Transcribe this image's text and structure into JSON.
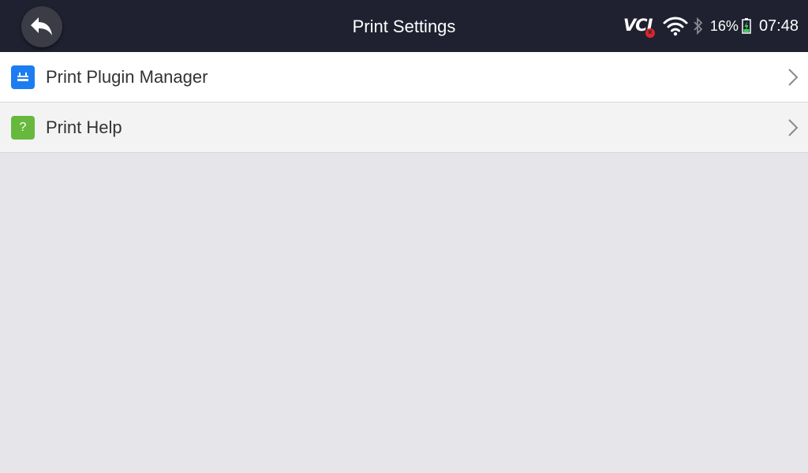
{
  "header": {
    "title": "Print Settings",
    "back_icon": "back-arrow-icon"
  },
  "status_bar": {
    "vci_label": "VCI",
    "vci_state_icon": "disconnected-x-icon",
    "battery_percent": "16%",
    "time": "07:48"
  },
  "menu": {
    "items": [
      {
        "label": "Print Plugin Manager",
        "icon": "plugin-icon",
        "icon_color": "#1e7cf2"
      },
      {
        "label": "Print Help",
        "icon": "help-question-icon",
        "icon_color": "#66b93c",
        "icon_text": "?"
      }
    ]
  },
  "colors": {
    "topbar": "#1f2130",
    "background": "#e6e5ea"
  }
}
